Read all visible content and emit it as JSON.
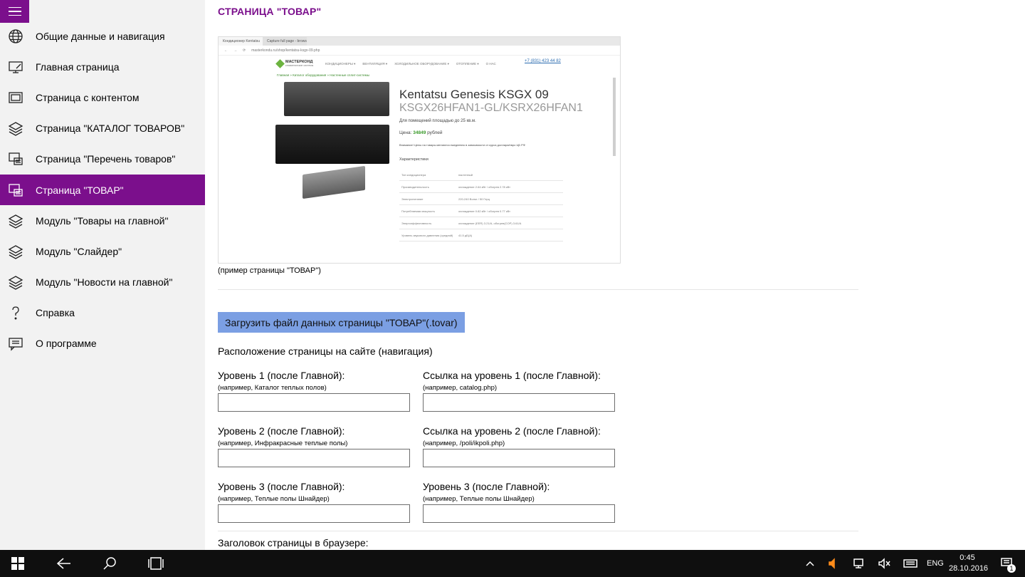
{
  "sidebar": {
    "items": [
      {
        "label": "Общие данные и навигация",
        "icon": "globe-icon"
      },
      {
        "label": "Главная страница",
        "icon": "monitor-edit-icon"
      },
      {
        "label": "Страница с контентом",
        "icon": "page-stack-icon"
      },
      {
        "label": "Страница \"КАТАЛОГ ТОВАРОВ\"",
        "icon": "layers-icon"
      },
      {
        "label": "Страница \"Перечень товаров\"",
        "icon": "list-page-icon"
      },
      {
        "label": "Страница \"ТОВАР\"",
        "icon": "product-page-icon",
        "active": true
      },
      {
        "label": "Модуль \"Товары на главной\"",
        "icon": "layers-icon"
      },
      {
        "label": "Модуль \"Слайдер\"",
        "icon": "layers-icon"
      },
      {
        "label": "Модуль \"Новости на главной\"",
        "icon": "layers-icon"
      },
      {
        "label": "Справка",
        "icon": "question-icon"
      },
      {
        "label": "О программе",
        "icon": "message-icon"
      }
    ]
  },
  "main": {
    "title": "СТРАНИЦА \"ТОВАР\"",
    "example_caption": "(пример страницы \"ТОВАР\")",
    "upload_button": "Загрузить файл данных страницы \"ТОВАР\"(.tovar)",
    "nav_section_label": "Расположение страницы на сайте (навигация)",
    "fields": [
      {
        "label": "Уровень 1 (после Главной):",
        "hint": "(например, Каталог теплых полов)",
        "value": ""
      },
      {
        "label": "Ссылка на уровень 1 (после Главной):",
        "hint": "(например, catalog.php)",
        "value": ""
      },
      {
        "label": "Уровень 2 (после Главной):",
        "hint": "(например, Инфракрасные теплые полы)",
        "value": ""
      },
      {
        "label": "Ссылка на уровень 2 (после Главной):",
        "hint": "(например, /poli/ikpoli.php)",
        "value": ""
      },
      {
        "label": "Уровень 3 (после Главной):",
        "hint": "(например, Теплые полы Шнайдер)",
        "value": ""
      },
      {
        "label": "Уровень 3 (после Главной):",
        "hint": "(например, Теплые полы Шнайдер)",
        "value": ""
      }
    ],
    "browser_title_label": "Заголовок страницы в браузере:"
  },
  "example_screenshot": {
    "tab1": "Кондиционер Kentatsu",
    "tab2": "Capture full page - browser",
    "url": "masterkondu.ru/shop/kentatsu-ksgx-09.php",
    "logo": "МАСТЕРКОНД",
    "logo_sub": "климатические системы",
    "menu": [
      "КОНДИЦИОНЕРЫ ▾",
      "ВЕНТИЛЯЦИЯ ▾",
      "ХОЛОДИЛЬНОЕ ОБОРУДОВАНИЕ ▾",
      "ОТОПЛЕНИЕ ▾",
      "О НАС"
    ],
    "phone": "+7 (831) 423 44 82",
    "breadcrumbs": "Главная » Каталог оборудования » Настенные сплит-системы",
    "product_title": "Kentatsu Genesis KSGX 09",
    "product_model": "KSGX26HFAN1-GL/KSRX26HFAN1",
    "area": "Для помещений площадью до 25 кв.м.",
    "price_label": "Цена:",
    "price_value": "34849",
    "price_currency": "рублей",
    "note": "Внимание! Цены на товары меняются ежедневно в зависимости от курса доллара/евро ЦБ РФ",
    "characteristics": "Характеристики",
    "spec_rows": [
      [
        "Тип кондиционера",
        "настенный"
      ],
      [
        "Производительность",
        "охлаждение 2.64 кВт / обогрев 2.78 кВт"
      ],
      [
        "Электропитание",
        "220-240 Вольт / 50 Герц"
      ],
      [
        "Потребляемая мощность",
        "охлаждение 0.82 кВт / обогрев 0.77 кВт"
      ],
      [
        "Энергоэффективность",
        "охлаждение (EER) 3.21/A, обогрев(COP) 3.61/A"
      ],
      [
        "Уровень звукового давления (средний)",
        "41.5 дБ(А)"
      ]
    ]
  },
  "taskbar": {
    "language": "ENG",
    "time": "0:45",
    "date": "28.10.2016",
    "notifications": "1"
  }
}
